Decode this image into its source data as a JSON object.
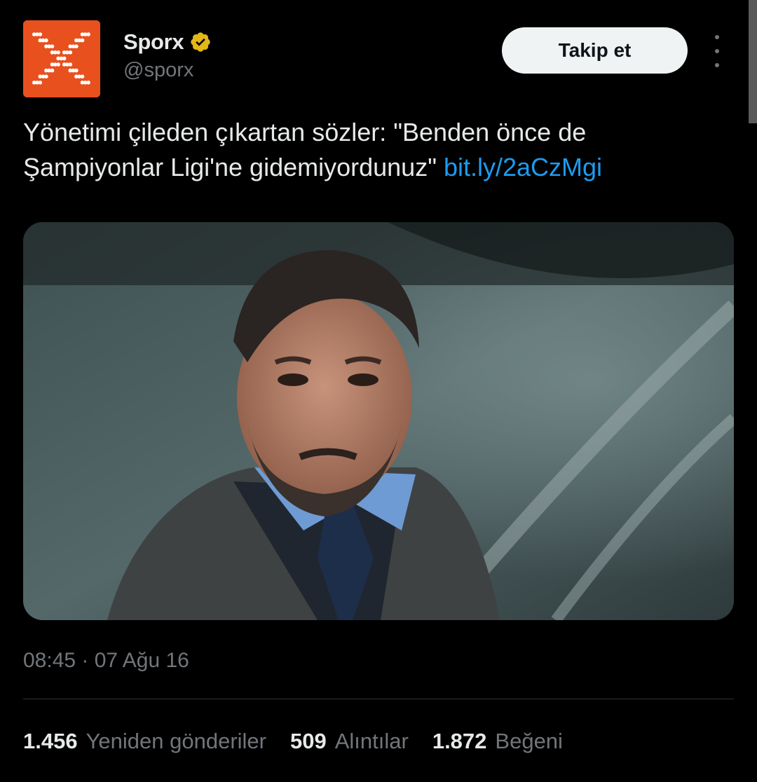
{
  "author": {
    "display_name": "Sporx",
    "handle": "@sporx",
    "avatar_icon": "sporx-x-logo",
    "avatar_color": "#e8501e",
    "verified_badge_color": "#e2b719"
  },
  "header": {
    "follow_label": "Takip et",
    "more_icon": "more-vertical-icon"
  },
  "tweet": {
    "text": "Yönetimi çileden çıkartan sözler: \"Benden önce de Şampiyonlar Ligi'ne gidemiyordunuz\" ",
    "link": "bit.ly/2aCzMgi",
    "link_color": "#1d9bf0",
    "timestamp": "08:45 · 07 Ağu 16"
  },
  "stats": {
    "retweets_count": "1.456",
    "retweets_label": "Yeniden gönderiler",
    "quotes_count": "509",
    "quotes_label": "Alıntılar",
    "likes_count": "1.872",
    "likes_label": "Beğeni"
  },
  "colors": {
    "background": "#000000",
    "primary_text": "#e7e9ea",
    "secondary_text": "#71767b",
    "divider": "#2f3336"
  }
}
